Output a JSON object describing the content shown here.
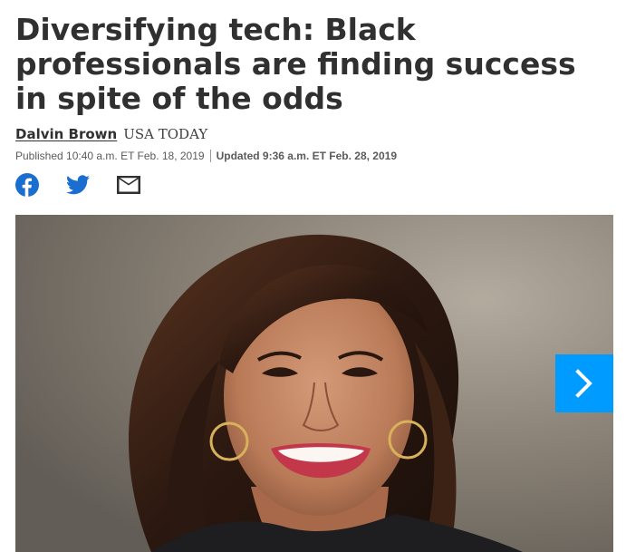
{
  "article": {
    "headline": "Diversifying tech: Black professionals are finding success in spite of the odds",
    "author": "Dalvin Brown",
    "outlet": "USA TODAY",
    "published": "Published 10:40 a.m. ET Feb. 18, 2019",
    "updated": "Updated 9:36 a.m. ET Feb. 28, 2019"
  },
  "share": {
    "icons": [
      "facebook-icon",
      "twitter-icon",
      "email-icon"
    ],
    "colors": {
      "social": "#1a6ecf",
      "email": "#303030"
    }
  },
  "gallery": {
    "next_icon": "chevron-right-icon",
    "accent": "#009bff"
  }
}
